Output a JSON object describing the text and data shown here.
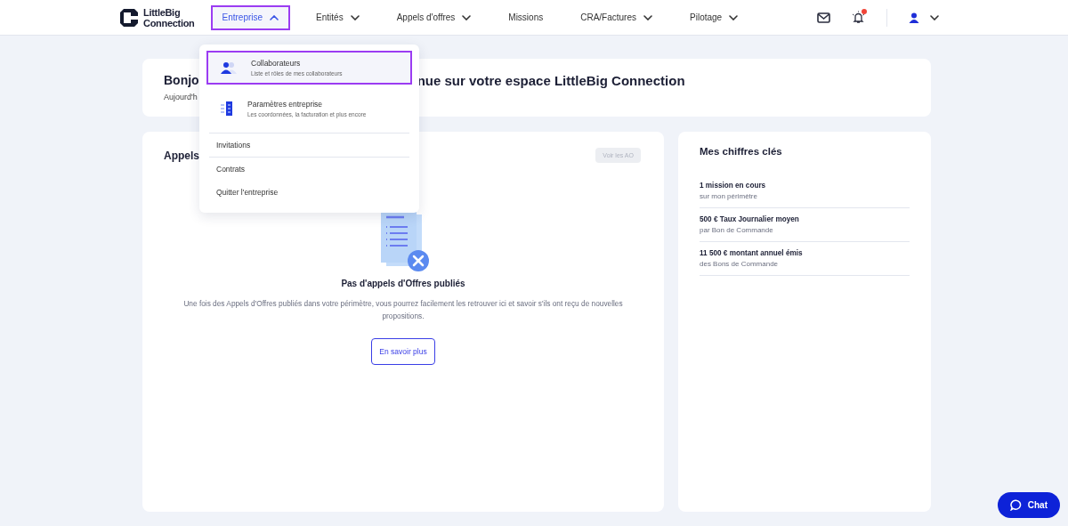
{
  "logo": {
    "line1": "LittleBig",
    "line2": "Connection"
  },
  "nav": [
    {
      "label": "Entreprise",
      "has_menu": true,
      "expanded": true,
      "selected": true
    },
    {
      "label": "Entités",
      "has_menu": true,
      "expanded": false,
      "selected": false
    },
    {
      "label": "Appels d'offres",
      "has_menu": true,
      "expanded": false,
      "selected": false
    },
    {
      "label": "Missions",
      "has_menu": false,
      "selected": false
    },
    {
      "label": "CRA/Factures",
      "has_menu": true,
      "expanded": false,
      "selected": false
    },
    {
      "label": "Pilotage",
      "has_menu": true,
      "expanded": false,
      "selected": false
    }
  ],
  "notifications": {
    "unread": true
  },
  "dropdown": {
    "items": [
      {
        "kind": "rich",
        "title": "Collaborateurs",
        "subtitle": "Liste et rôles de mes collaborateurs",
        "selected": true
      },
      {
        "kind": "rich",
        "title": "Paramètres entreprise",
        "subtitle": "Les coordonnées, la facturation et plus encore",
        "selected": false
      },
      {
        "kind": "plain",
        "title": "Invitations",
        "selected": false
      },
      {
        "kind": "plain",
        "title": "Contrats",
        "selected": false
      },
      {
        "kind": "plain",
        "title": "Quitter l'entreprise",
        "selected": false
      }
    ]
  },
  "greeting": {
    "title_start": "Bonjo",
    "title_end": "nue sur votre espace LittleBig Connection",
    "subtitle_start": "Aujourd'h"
  },
  "offers_card": {
    "title_start": "Appels",
    "button": {
      "label": "Voir les AO",
      "disabled": true
    },
    "empty_title": "Pas d'appels d'Offres publiés",
    "empty_text": "Une fois des Appels d'Offres publiés dans votre périmètre, vous pourrez facilement les retrouver ici et savoir s'ils ont reçu de nouvelles propositions.",
    "link_button": "En savoir plus"
  },
  "key_figures": {
    "title": "Mes chiffres clés",
    "items": [
      {
        "value": "1 mission en cours",
        "caption": "sur mon périmètre"
      },
      {
        "value": "500 € Taux Journalier moyen",
        "caption": "par Bon de Commande"
      },
      {
        "value": "11 500 € montant annuel émis",
        "caption": "des Bons de Commande"
      }
    ]
  },
  "chat": {
    "label": "Chat"
  }
}
